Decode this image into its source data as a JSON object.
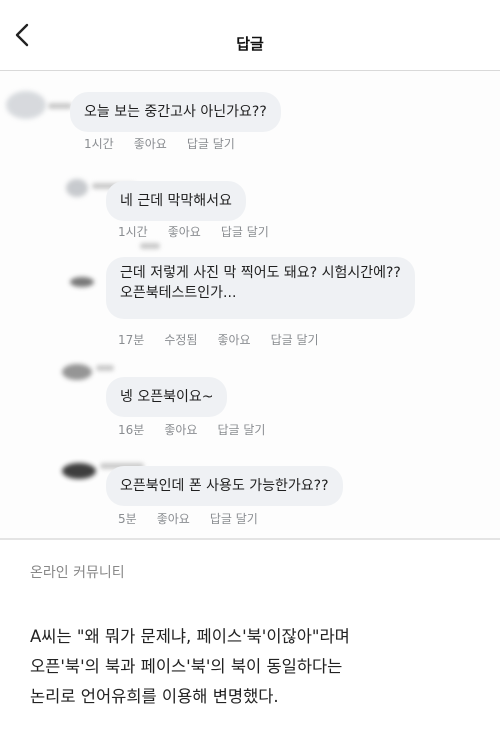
{
  "header": {
    "title": "답글",
    "back_icon": "chevron-left-icon"
  },
  "comments": [
    {
      "text_lines": [
        "오늘 보는 중간고사 아닌가요??"
      ],
      "time": "1시간",
      "edited": "",
      "like": "좋아요",
      "reply": "답글 달기"
    },
    {
      "text_lines": [
        "네 근데 막막해서요"
      ],
      "time": "1시간",
      "edited": "",
      "like": "좋아요",
      "reply": "답글 달기"
    },
    {
      "text_lines": [
        "근데 저렇게 사진 막 찍어도 돼요? 시험시간에??",
        "오픈북테스트인가..."
      ],
      "time": "17분",
      "edited": "수정됨",
      "like": "좋아요",
      "reply": "답글 달기"
    },
    {
      "text_lines": [
        "넹 오픈북이요~"
      ],
      "time": "16분",
      "edited": "",
      "like": "좋아요",
      "reply": "답글 달기"
    },
    {
      "text_lines": [
        "오픈북인데 폰 사용도 가능한가요??"
      ],
      "time": "5분",
      "edited": "",
      "like": "좋아요",
      "reply": "답글 달기"
    }
  ],
  "caption": "온라인 커뮤니티",
  "article": {
    "lines": [
      "A씨는 \"왜 뭐가 문제냐, 페이스'북'이잖아\"라며",
      "오픈'북'의 북과 페이스'북'의 북이 동일하다는",
      "논리로 언어유희를 이용해 변명했다."
    ]
  }
}
